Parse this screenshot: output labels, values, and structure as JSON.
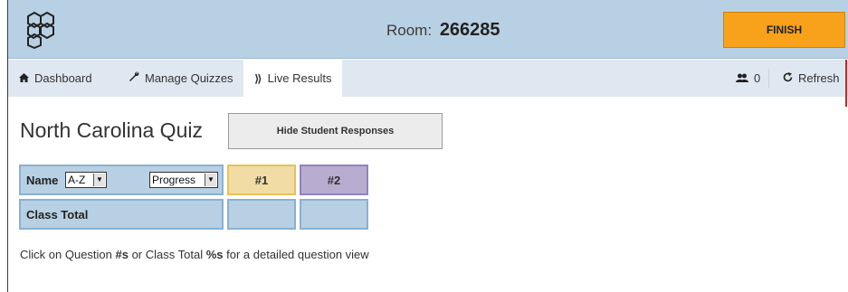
{
  "header": {
    "room_label": "Room:",
    "room_number": "266285",
    "finish_label": "FINISH"
  },
  "nav": {
    "items": [
      {
        "label": "Dashboard",
        "icon": "home-icon"
      },
      {
        "label": "Manage Quizzes",
        "icon": "wrench-icon"
      },
      {
        "label": "Live Results",
        "icon": "live-icon"
      }
    ],
    "student_count": "0",
    "refresh_label": "Refresh"
  },
  "quiz": {
    "title": "North Carolina Quiz",
    "hide_responses_label": "Hide Student Responses"
  },
  "table": {
    "name_label": "Name",
    "sort_value": "A-Z",
    "view_value": "Progress",
    "questions": [
      "#1",
      "#2"
    ],
    "class_total_label": "Class Total"
  },
  "hint": {
    "part1": "Click on Question ",
    "bold1": "#s",
    "part2": " or Class Total ",
    "bold2": "%s",
    "part3": " for a detailed question view"
  },
  "colors": {
    "header_bg": "#b8d0e3",
    "finish_bg": "#f7a21a",
    "q1_bg": "#f0dca4",
    "q2_bg": "#b8add0"
  }
}
